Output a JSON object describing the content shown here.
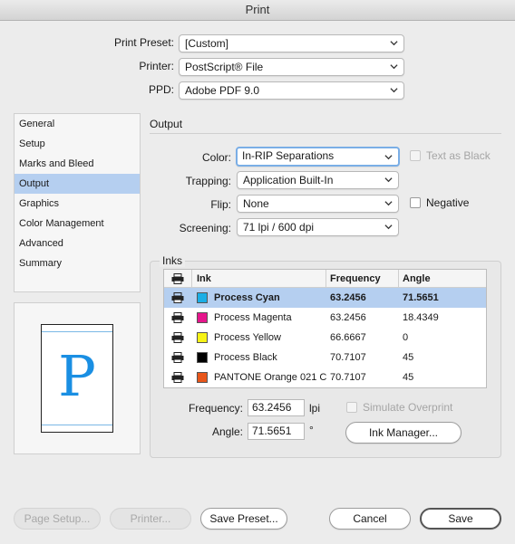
{
  "window": {
    "title": "Print"
  },
  "top": {
    "print_preset_label": "Print Preset:",
    "print_preset_value": "[Custom]",
    "printer_label": "Printer:",
    "printer_value": "PostScript® File",
    "ppd_label": "PPD:",
    "ppd_value": "Adobe PDF 9.0"
  },
  "sidebar": {
    "items": [
      {
        "label": "General",
        "selected": false
      },
      {
        "label": "Setup",
        "selected": false
      },
      {
        "label": "Marks and Bleed",
        "selected": false
      },
      {
        "label": "Output",
        "selected": true
      },
      {
        "label": "Graphics",
        "selected": false
      },
      {
        "label": "Color Management",
        "selected": false
      },
      {
        "label": "Advanced",
        "selected": false
      },
      {
        "label": "Summary",
        "selected": false
      }
    ]
  },
  "preview": {
    "glyph": "P",
    "accent": "#1a8fe3"
  },
  "output": {
    "section_title": "Output",
    "color_label": "Color:",
    "color_value": "In-RIP Separations",
    "text_as_black_label": "Text as Black",
    "trapping_label": "Trapping:",
    "trapping_value": "Application Built-In",
    "flip_label": "Flip:",
    "flip_value": "None",
    "negative_label": "Negative",
    "screening_label": "Screening:",
    "screening_value": "71 lpi / 600 dpi"
  },
  "inks": {
    "section_title": "Inks",
    "columns": {
      "ink": "Ink",
      "frequency": "Frequency",
      "angle": "Angle"
    },
    "rows": [
      {
        "name": "Process Cyan",
        "frequency": "63.2456",
        "angle": "71.5651",
        "color": "#1aaee6",
        "selected": true
      },
      {
        "name": "Process Magenta",
        "frequency": "63.2456",
        "angle": "18.4349",
        "color": "#e6168c",
        "selected": false
      },
      {
        "name": "Process Yellow",
        "frequency": "66.6667",
        "angle": "0",
        "color": "#f7f316",
        "selected": false
      },
      {
        "name": "Process Black",
        "frequency": "70.7107",
        "angle": "45",
        "color": "#000000",
        "selected": false
      },
      {
        "name": "PANTONE Orange 021 C",
        "frequency": "70.7107",
        "angle": "45",
        "color": "#e8561a",
        "selected": false
      }
    ],
    "frequency_label": "Frequency:",
    "frequency_value": "63.2456",
    "frequency_unit": "lpi",
    "angle_label": "Angle:",
    "angle_value": "71.5651",
    "angle_unit": "°",
    "simulate_overprint_label": "Simulate Overprint",
    "ink_manager_label": "Ink Manager..."
  },
  "footer": {
    "page_setup_label": "Page Setup...",
    "printer_label": "Printer...",
    "save_preset_label": "Save Preset...",
    "cancel_label": "Cancel",
    "save_label": "Save"
  }
}
